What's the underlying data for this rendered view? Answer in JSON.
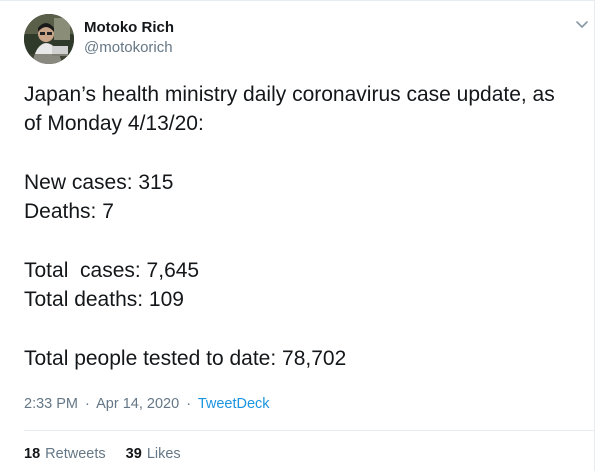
{
  "author": {
    "name": "Motoko Rich",
    "handle": "@motokorich"
  },
  "tweet": {
    "lines": [
      "Japan’s health ministry daily coronavirus case update, as",
      "of Monday 4/13/20:",
      "New cases: 315",
      "Deaths: 7",
      "Total  cases: 7,645",
      "Total deaths: 109",
      "Total people tested to date: 78,702"
    ]
  },
  "meta": {
    "time": "2:33 PM",
    "separator": "·",
    "date": "Apr 14, 2020",
    "source": "TweetDeck"
  },
  "stats": {
    "retweets_count": "18",
    "retweets_label": "Retweets",
    "likes_count": "39",
    "likes_label": "Likes"
  },
  "colors": {
    "text": "#14171a",
    "secondary": "#657786",
    "link": "#1b95e0",
    "border": "#e6ecf0"
  },
  "icons": {
    "caret": "chevron-down-icon"
  }
}
